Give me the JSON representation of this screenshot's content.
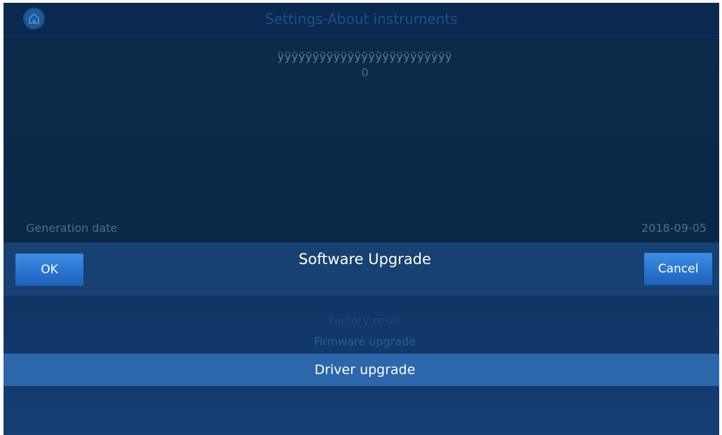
{
  "header": {
    "title": "Settings-About instruments",
    "home_icon": "home-icon"
  },
  "info": {
    "device_name": "ÿÿÿÿÿÿÿÿÿÿÿÿÿÿÿÿÿÿÿÿÿÿÿÿÿ",
    "device_value": "0",
    "generation_label": "Generation date",
    "generation_value": "2018-09-05"
  },
  "dialog": {
    "title": "Software Upgrade",
    "ok_label": "OK",
    "cancel_label": "Cancel",
    "options": [
      "Factory reset",
      "Firmware upgrade",
      "Driver upgrade"
    ],
    "selected": "Driver upgrade"
  },
  "colors": {
    "background": "#0b2848",
    "dialog_header": "#164172",
    "button": "#2a74cf",
    "selected_row": "#2c66ab"
  }
}
